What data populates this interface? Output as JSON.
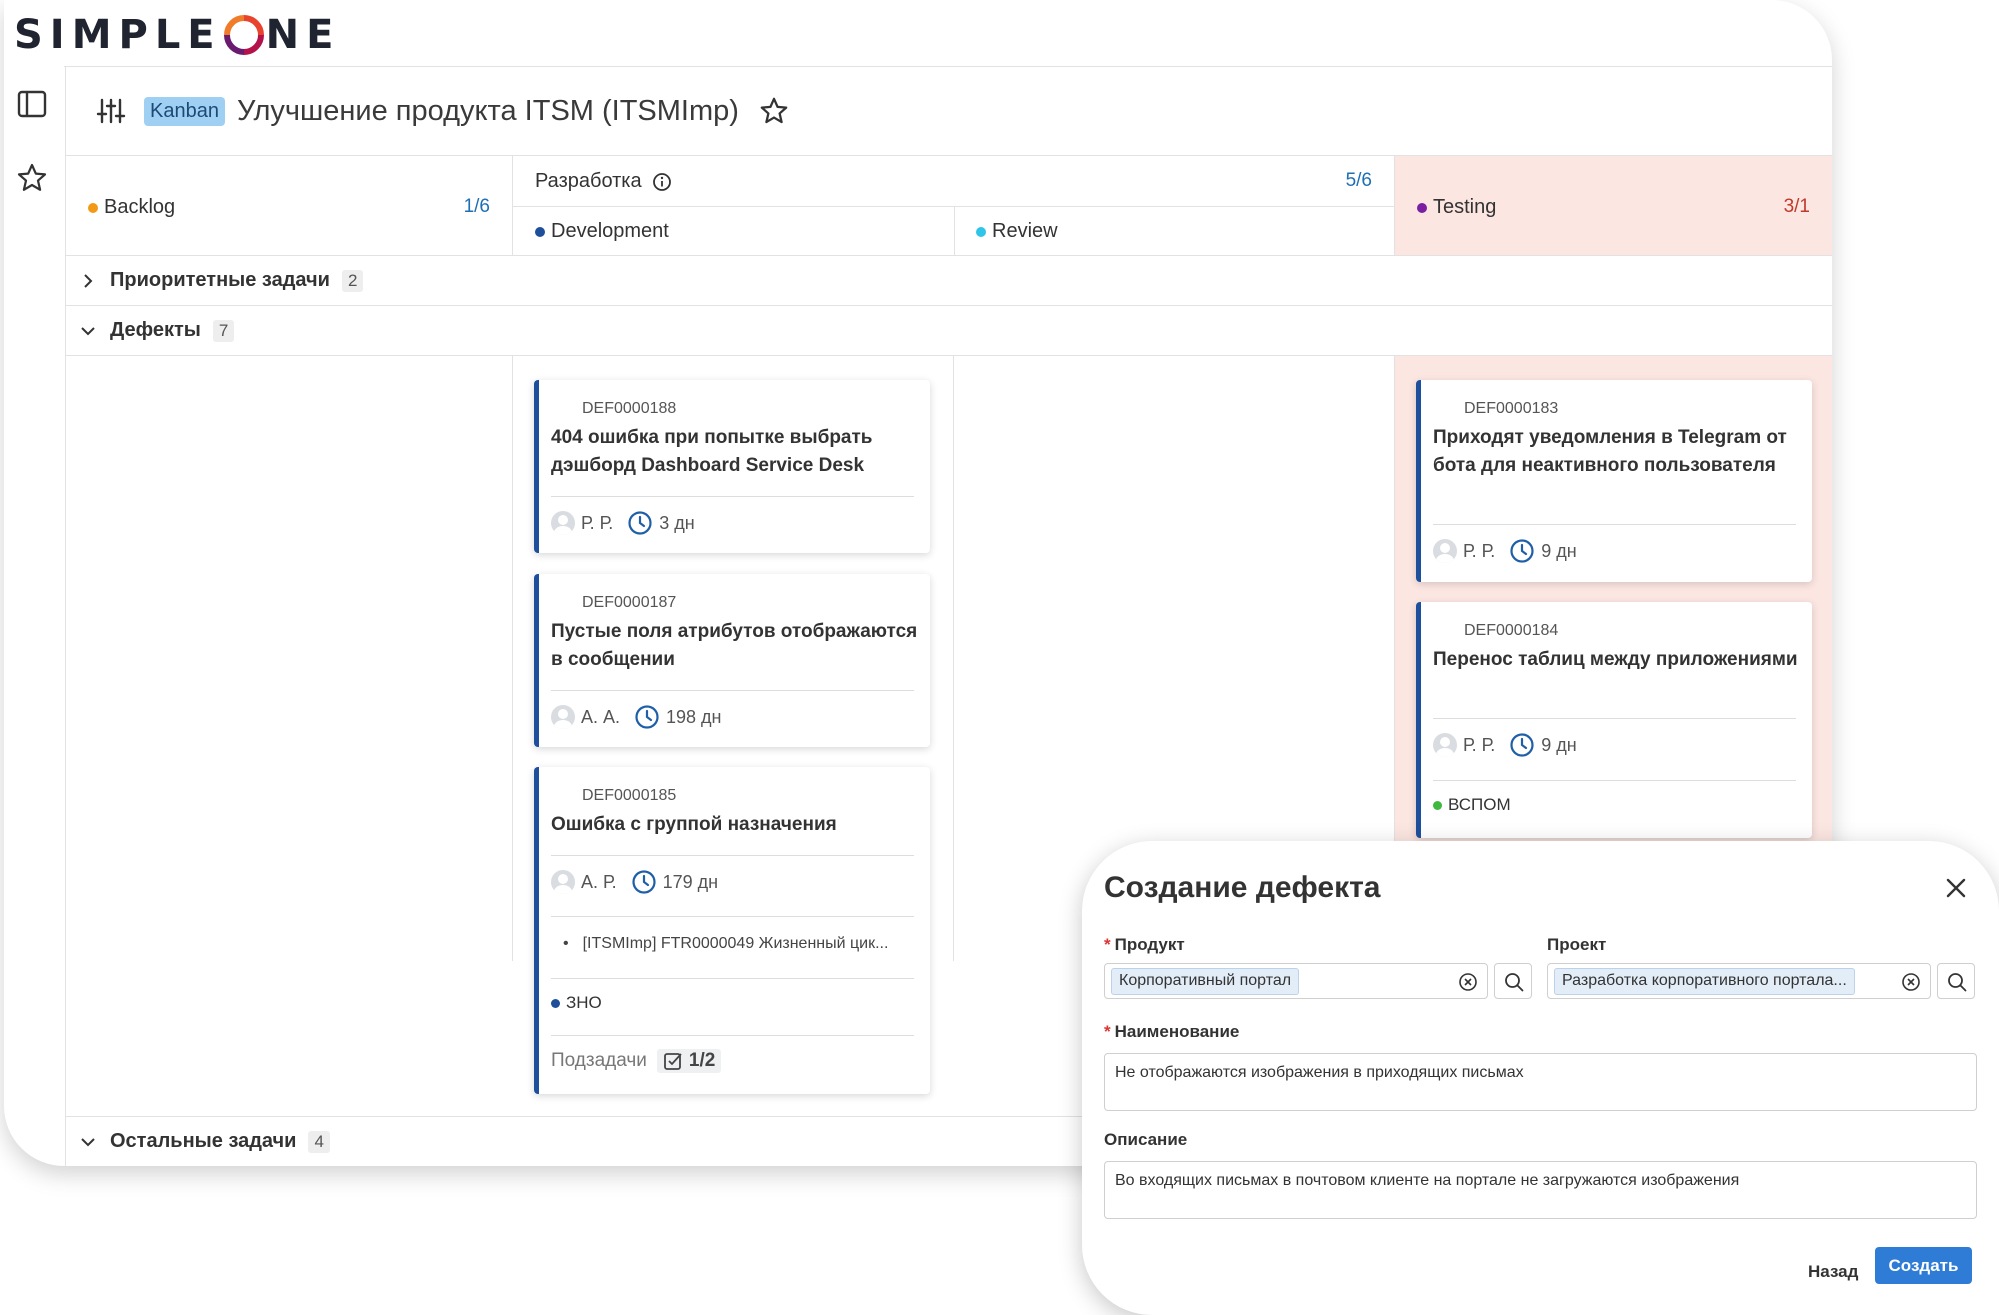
{
  "brand": {
    "logo_left": "SIMPLE",
    "logo_right": "NE"
  },
  "board": {
    "badge": "Kanban",
    "title": "Улучшение продукта ITSM (ITSMImp)"
  },
  "columns": {
    "backlog": {
      "name": "Backlog",
      "count": "1/6",
      "color": "#f29a16"
    },
    "dev_group": {
      "name": "Разработка",
      "count": "5/6"
    },
    "development": {
      "name": "Development",
      "color": "#1e4f9c"
    },
    "review": {
      "name": "Review",
      "color": "#2ec5e8"
    },
    "testing": {
      "name": "Testing",
      "count": "3/1",
      "color": "#7a1fa2",
      "bg": "#fce6e2"
    }
  },
  "swimlanes": {
    "priority": {
      "label": "Приоритетные задачи",
      "count": "2"
    },
    "defects": {
      "label": "Дефекты",
      "count": "7"
    },
    "other": {
      "label": "Остальные задачи",
      "count": "4"
    }
  },
  "cards": {
    "c188": {
      "id": "DEF0000188",
      "title": "404 ошибка при попытке выбрать дэшборд Dashboard Service Desk",
      "assignee": "Р. Р.",
      "age": "3 дн"
    },
    "c187": {
      "id": "DEF0000187",
      "title": "Пустые поля атрибутов отображаются в сообщении",
      "assignee": "А. А.",
      "age": "198 дн"
    },
    "c185": {
      "id": "DEF0000185",
      "title": "Ошибка с группой назначения",
      "assignee": "А. Р.",
      "age": "179 дн",
      "link": "[ITSMImp] FTR0000049 Жизненный цик...",
      "tag": "ЗНО",
      "tag_color": "#1e4f9c",
      "subtasks_label": "Подзадачи",
      "subtasks_count": "1/2"
    },
    "c183": {
      "id": "DEF0000183",
      "title": "Приходят уведомления в Telegram от бота для неактивного пользователя",
      "assignee": "Р. Р.",
      "age": "9 дн"
    },
    "c184": {
      "id": "DEF0000184",
      "title": "Перенос таблиц между приложениями",
      "assignee": "Р. Р.",
      "age": "9 дн",
      "tag": "ВСПОМ",
      "tag_color": "#3fb83f"
    }
  },
  "dialog": {
    "title": "Создание дефекта",
    "product_label": "Продукт",
    "product_value": "Корпоративный портал",
    "project_label": "Проект",
    "project_value": "Разработка корпоративного портала...",
    "name_label": "Наименование",
    "name_value": "Не отображаются изображения в приходящих письмах",
    "desc_label": "Описание",
    "desc_value": "Во входящих письмах в почтовом клиенте на портале не загружаются изображения",
    "back_label": "Назад",
    "create_label": "Создать"
  }
}
